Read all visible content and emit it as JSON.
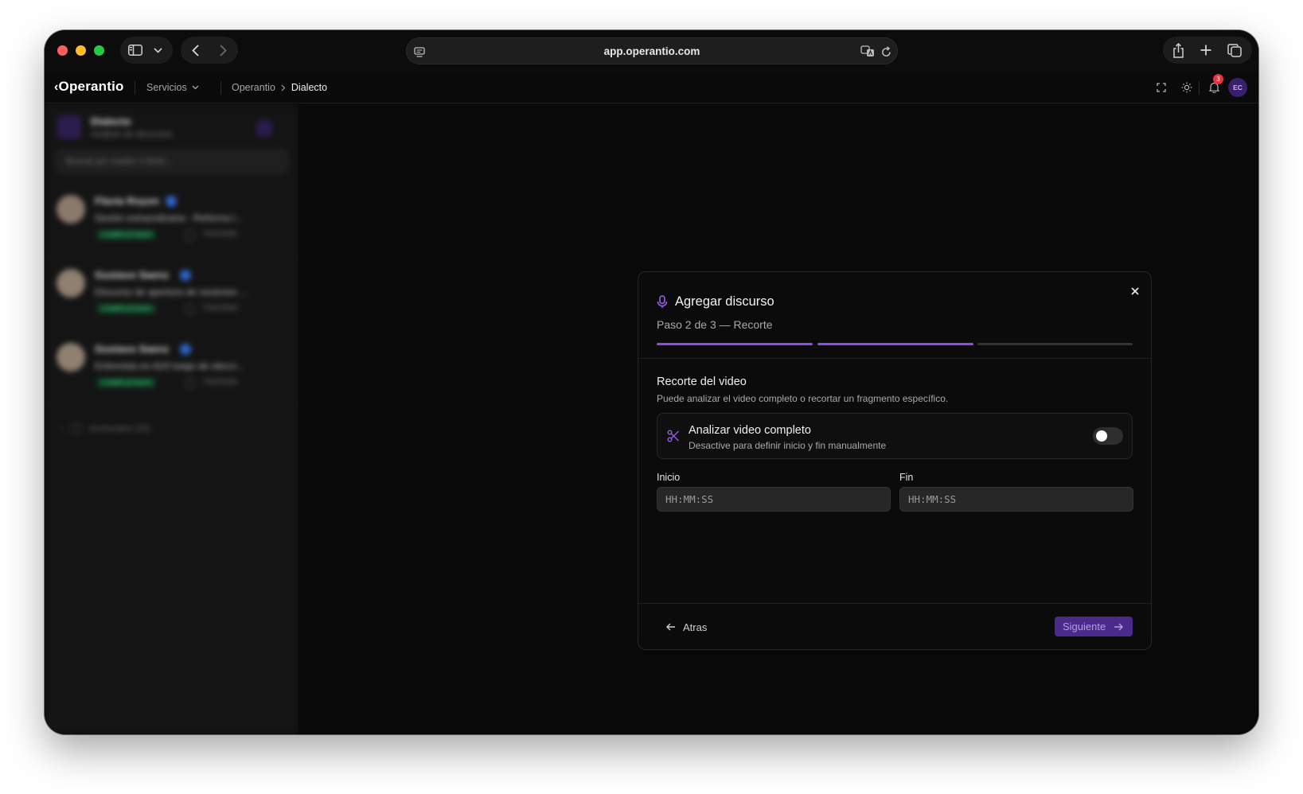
{
  "browser": {
    "url": "app.operantio.com",
    "colors": {
      "close": "#ff5f57",
      "minimize": "#febc2e",
      "maximize": "#28c840"
    }
  },
  "header": {
    "logo": "Operantio",
    "services_label": "Servicios",
    "breadcrumb": [
      "Operantio",
      "Dialecto"
    ],
    "notification_count": "3",
    "avatar_initials": "EC"
  },
  "sidebar": {
    "title": "Dialecto",
    "subtitle": "Análisis de discursos",
    "search_placeholder": "Buscar por orador o título...",
    "items": [
      {
        "name": "Flavia Royon",
        "subtitle": "Sesión extraordinaria - Reforma l...",
        "status": "COMPLETADO",
        "date": "7/02/2026"
      },
      {
        "name": "Gustavo Saenz",
        "subtitle": "Discurso de apertura de sesiones ...",
        "status": "COMPLETADO",
        "date": "7/02/2026"
      },
      {
        "name": "Gustavo Saenz",
        "subtitle": "Entrevista en A24 luego de elecci...",
        "status": "COMPLETADO",
        "date": "7/02/2026"
      }
    ],
    "archived_label": "Archivados (33)"
  },
  "modal": {
    "title": "Agregar discurso",
    "step": "Paso 2 de 3 — Recorte",
    "progress": {
      "current": 2,
      "total": 3
    },
    "section_title": "Recorte del video",
    "section_desc": "Puede analizar el video completo o recortar un fragmento específico.",
    "option_title": "Analizar video completo",
    "option_desc": "Desactive para definir inicio y fin manualmente",
    "option_enabled": false,
    "start_label": "Inicio",
    "start_placeholder": "HH:MM:SS",
    "end_label": "Fin",
    "end_placeholder": "HH:MM:SS",
    "back_label": "Atras",
    "next_label": "Siguiente",
    "accent": "#8b4fe0"
  }
}
